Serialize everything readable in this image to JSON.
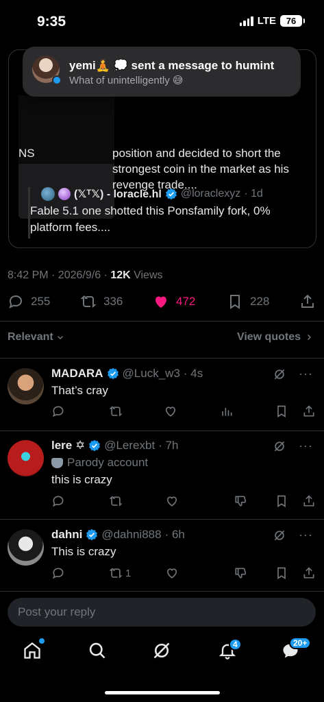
{
  "status_bar": {
    "time": "9:35",
    "network": "LTE",
    "battery": "76"
  },
  "notification": {
    "title": "yemi🧘 💭 sent a message to humint",
    "subtitle": "What of unintelligently 😅"
  },
  "quote": {
    "thumb_text": "NS",
    "body": "position and decided to short the strongest coin in the market as his revenge trade....",
    "nested": {
      "name": "(𝕏ᵀ𝕏) - loracle.hl",
      "handle": "@loraclexyz",
      "time": "· 1d",
      "text": "Fable 5.1 one shotted this Ponsfamily fork, 0% platform fees...."
    }
  },
  "post_meta": {
    "datetime": "8:42 PM · 2026/9/6 · ",
    "views_count": "12K",
    "views_label": " Views"
  },
  "actions": {
    "replies": "255",
    "reposts": "336",
    "likes": "472",
    "bookmarks": "228"
  },
  "sort": {
    "label": "Relevant",
    "quotes_label": "View quotes"
  },
  "replies": [
    {
      "name": "MADARA",
      "handle": "@Luck_w3",
      "time": "· 4s",
      "text": "That’s cray",
      "reposts": ""
    },
    {
      "name": "lere ✡",
      "handle": "@Lerexbt",
      "time": "· 7h",
      "parody": "Parody account",
      "text": "this is crazy",
      "reposts": ""
    },
    {
      "name": "dahni",
      "handle": "@dahni888",
      "time": "· 6h",
      "text": "This is crazy",
      "reposts": "1"
    }
  ],
  "reply_box": {
    "placeholder": "Post your reply"
  },
  "nav": {
    "notifications_badge": "4",
    "messages_badge": "20+"
  },
  "colors": {
    "accent": "#1d9bf0",
    "like": "#f91880",
    "muted": "#71767b"
  }
}
